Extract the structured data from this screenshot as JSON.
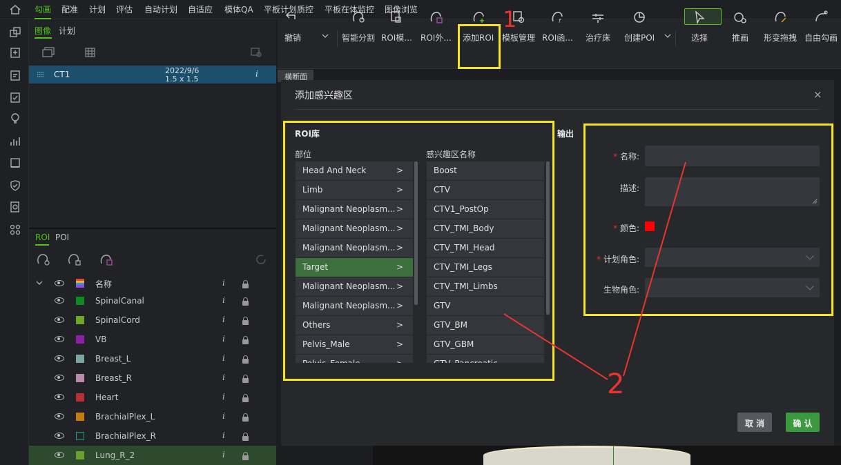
{
  "topnav": {
    "items": [
      "勾画",
      "配准",
      "计划",
      "评估",
      "自动计划",
      "自适应",
      "模体QA",
      "平板计划质控",
      "平板在体监控",
      "图像浏览"
    ],
    "active": "勾画"
  },
  "leftpanel": {
    "tabs": [
      "图像",
      "计划"
    ],
    "image_row": {
      "name": "CT1",
      "date": "2022/9/6",
      "spacing": "1.5 x 1.5",
      "info": "i"
    },
    "roi_tabs": [
      "ROI",
      "POI"
    ],
    "roi_header": {
      "name": "名称",
      "info": "i"
    },
    "rois": [
      {
        "name": "SpinalCanal",
        "color": "#0e8a24",
        "hollow": false
      },
      {
        "name": "SpinalCord",
        "color": "#6ea62a",
        "hollow": false
      },
      {
        "name": "VB",
        "color": "#8a1fa6",
        "hollow": false
      },
      {
        "name": "Breast_L",
        "color": "#7fa3a3",
        "hollow": false
      },
      {
        "name": "Breast_R",
        "color": "#b98aaa",
        "hollow": false
      },
      {
        "name": "Heart",
        "color": "#b8303a",
        "hollow": false
      },
      {
        "name": "BrachialPlex_L",
        "color": "#c77a13",
        "hollow": false
      },
      {
        "name": "BrachialPlex_R",
        "color": "#1b9a92",
        "hollow": true
      },
      {
        "name": "Lung_R_2",
        "color": "#6aa12e",
        "hollow": false
      }
    ]
  },
  "toolbar": {
    "items": [
      {
        "label": "撤销",
        "icon": "undo-icon"
      },
      {
        "label": "智能分割",
        "icon": "smart-segment-icon"
      },
      {
        "label": "ROI模...",
        "icon": "roi-template-icon"
      },
      {
        "label": "ROI外...",
        "icon": "roi-outer-icon"
      },
      {
        "label": "添加ROI",
        "icon": "add-roi-icon"
      },
      {
        "label": "模板管理",
        "icon": "template-manage-icon"
      },
      {
        "label": "ROI函...",
        "icon": "roi-function-icon"
      },
      {
        "label": "治疗床",
        "icon": "couch-icon"
      },
      {
        "label": "创建POI",
        "icon": "create-poi-icon"
      },
      {
        "label": "选择",
        "icon": "select-icon"
      },
      {
        "label": "推画",
        "icon": "push-draw-icon"
      },
      {
        "label": "形变拖拽",
        "icon": "deform-drag-icon"
      },
      {
        "label": "自由勾画",
        "icon": "free-draw-icon"
      }
    ]
  },
  "crumb": "横断面",
  "modal": {
    "title": "添加感兴趣区",
    "close": "×",
    "library": {
      "title": "ROI库",
      "col1_header": "部位",
      "col2_header": "感兴趣区名称",
      "sites": [
        {
          "label": "Head And Neck",
          "selected": false
        },
        {
          "label": "Limb",
          "selected": false
        },
        {
          "label": "Malignant Neoplasm...",
          "selected": false
        },
        {
          "label": "Malignant Neoplasm...",
          "selected": false
        },
        {
          "label": "Malignant Neoplasm...",
          "selected": false
        },
        {
          "label": "Target",
          "selected": true
        },
        {
          "label": "Malignant Neoplasm...",
          "selected": false
        },
        {
          "label": "Malignant Neoplasm...",
          "selected": false
        },
        {
          "label": "Others",
          "selected": false
        },
        {
          "label": "Pelvis_Male",
          "selected": false
        },
        {
          "label": "Pelvis_Female",
          "selected": false
        }
      ],
      "arrow": ">",
      "roi_names": [
        "Boost",
        "CTV",
        "CTV1_PostOp",
        "CTV_TMI_Body",
        "CTV_TMI_Head",
        "CTV_TMI_Legs",
        "CTV_TMI_Limbs",
        "GTV",
        "GTV_BM",
        "GTV_GBM",
        "GTV_Pancreatic"
      ]
    },
    "output": {
      "title": "输出",
      "name_label": "名称:",
      "desc_label": "描述:",
      "color_label": "颜色:",
      "color_value": "#ff0000",
      "plan_role_label": "计划角色:",
      "bio_role_label": "生物角色:",
      "required_mark": "*"
    },
    "cancel": "取 消",
    "confirm": "确 认"
  },
  "annotations": {
    "one": "1",
    "two": "2"
  },
  "colors": {
    "accent": "#52c41a",
    "highlight": "#f5e51a",
    "annotation": "#e8352e"
  }
}
